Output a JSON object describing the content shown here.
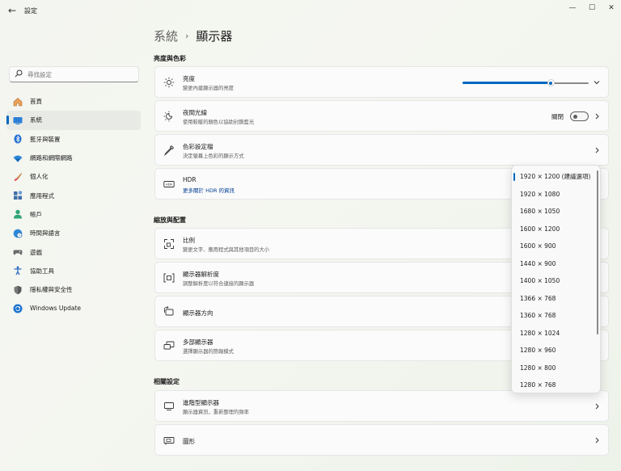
{
  "window": {
    "title": "設定",
    "back": "←",
    "minimize": "—",
    "maximize": "☐",
    "close": "✕"
  },
  "search": {
    "placeholder": "尋找設定"
  },
  "sidebar": {
    "items": [
      {
        "label": "首頁",
        "icon": "home-icon"
      },
      {
        "label": "系統",
        "icon": "system-icon",
        "active": true
      },
      {
        "label": "藍牙與裝置",
        "icon": "bluetooth-icon"
      },
      {
        "label": "網路和網際網路",
        "icon": "wifi-icon"
      },
      {
        "label": "個人化",
        "icon": "brush-icon"
      },
      {
        "label": "應用程式",
        "icon": "apps-icon"
      },
      {
        "label": "帳戶",
        "icon": "account-icon"
      },
      {
        "label": "時間與語言",
        "icon": "globe-clock-icon"
      },
      {
        "label": "遊戲",
        "icon": "gamepad-icon"
      },
      {
        "label": "協助工具",
        "icon": "accessibility-icon"
      },
      {
        "label": "隱私權與安全性",
        "icon": "shield-icon"
      },
      {
        "label": "Windows Update",
        "icon": "update-icon"
      }
    ]
  },
  "breadcrumb": {
    "parent": "系統",
    "separator": "›",
    "current": "顯示器"
  },
  "sections": {
    "brightness": {
      "heading": "亮度與色彩"
    },
    "scale": {
      "heading": "縮放與配置"
    },
    "related": {
      "heading": "相關設定"
    }
  },
  "cards": {
    "brightness": {
      "title": "亮度",
      "subtitle": "變更內建顯示器的亮度",
      "value_percent": 70
    },
    "night_light": {
      "title": "夜間光線",
      "subtitle": "使用較暖的顏色以協助封鎖藍光",
      "toggle_label": "關閉",
      "toggle_on": false
    },
    "color_profile": {
      "title": "色彩設定檔",
      "subtitle": "決定螢幕上色彩的顯示方式"
    },
    "hdr": {
      "title": "HDR",
      "link": "更多關於 HDR 的資訊"
    },
    "scale": {
      "title": "比例",
      "subtitle": "變更文字、應用程式與其他項目的大小"
    },
    "resolution": {
      "title": "顯示器解析度",
      "subtitle": "調整解析度以符合連接的顯示器"
    },
    "orientation": {
      "title": "顯示器方向"
    },
    "multi": {
      "title": "多部顯示器",
      "subtitle": "選擇顯示器的簡報模式"
    },
    "advanced": {
      "title": "進階型顯示器",
      "subtitle": "顯示器資訊，重新整理的頻率"
    },
    "graphics": {
      "title": "圖形"
    }
  },
  "resolution_dropdown": {
    "selected": "1920 × 1200 (建議選項)",
    "options": [
      "1920 × 1200 (建議選項)",
      "1920 × 1080",
      "1680 × 1050",
      "1600 × 1200",
      "1600 × 900",
      "1440 × 900",
      "1400 × 1050",
      "1366 × 768",
      "1360 × 768",
      "1280 × 1024",
      "1280 × 960",
      "1280 × 800",
      "1280 × 768"
    ]
  },
  "colors": {
    "accent": "#0067c0",
    "link": "#003e92"
  }
}
